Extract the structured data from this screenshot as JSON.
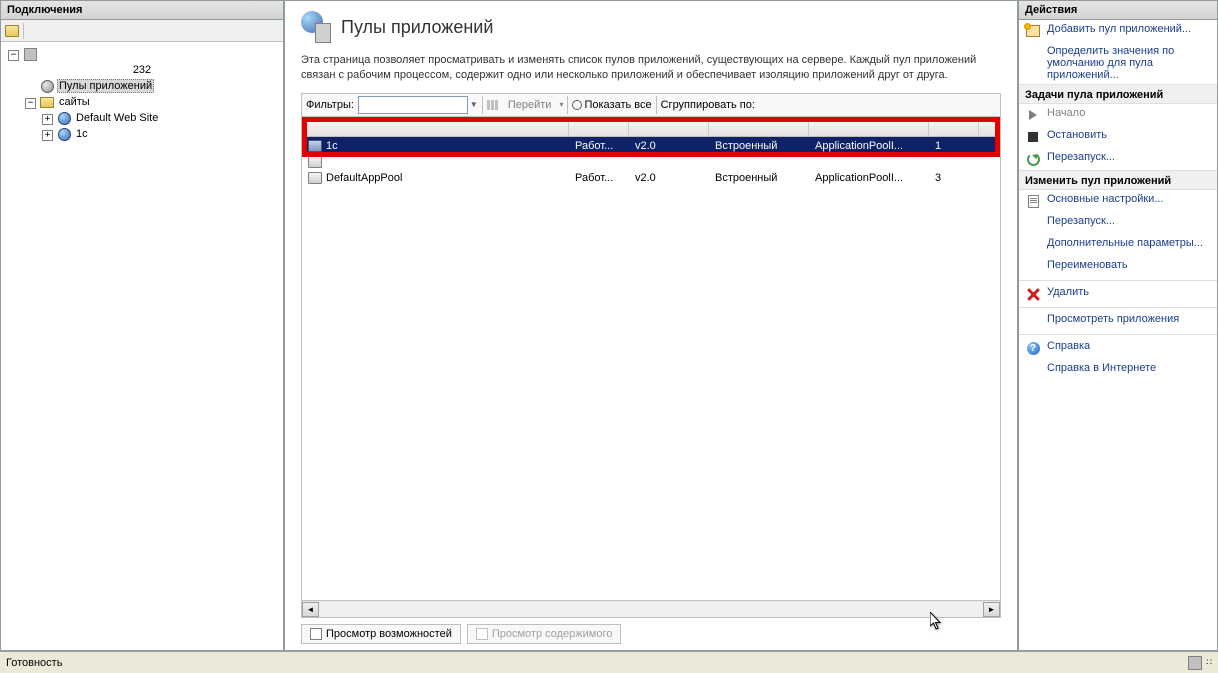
{
  "connections": {
    "title": "Подключения",
    "serverName": "232",
    "nodes": {
      "appPools": "Пулы приложений",
      "sites": "сайты",
      "defaultSite": "Default Web Site",
      "site1c": "1c"
    }
  },
  "main": {
    "title": "Пулы приложений",
    "description": "Эта страница позволяет просматривать и изменять список пулов приложений, существующих на сервере. Каждый пул приложений связан с рабочим процессом, содержит одно или несколько приложений и обеспечивает изоляцию приложений друг от друга.",
    "filter": {
      "label": "Фильтры:",
      "goBtn": "Перейти",
      "showAll": "Показать все",
      "groupBy": "Сгруппировать по:"
    },
    "rows": [
      {
        "name": "1c",
        "state": "Работ...",
        "ver": "v2.0",
        "mode": "Встроенный",
        "identity": "ApplicationPoolI...",
        "apps": "1",
        "selected": true
      },
      {
        "name": "DefaultAppPool",
        "state": "Работ...",
        "ver": "v2.0",
        "mode": "Встроенный",
        "identity": "ApplicationPoolI...",
        "apps": "3",
        "selected": false
      }
    ],
    "bottomTabs": {
      "features": "Просмотр возможностей",
      "content": "Просмотр содержимого"
    }
  },
  "actions": {
    "title": "Действия",
    "add": "Добавить пул приложений...",
    "setDefaults": "Определить значения по умолчанию для пула приложений...",
    "section1": "Задачи пула приложений",
    "start": "Начало",
    "stop": "Остановить",
    "recycle": "Перезапуск...",
    "section2": "Изменить пул приложений",
    "basic": "Основные настройки...",
    "restart": "Перезапуск...",
    "advanced": "Дополнительные параметры...",
    "rename": "Переименовать",
    "delete": "Удалить",
    "viewApps": "Просмотреть приложения",
    "help": "Справка",
    "helpOnline": "Справка в Интернете"
  },
  "statusBar": "Готовность"
}
